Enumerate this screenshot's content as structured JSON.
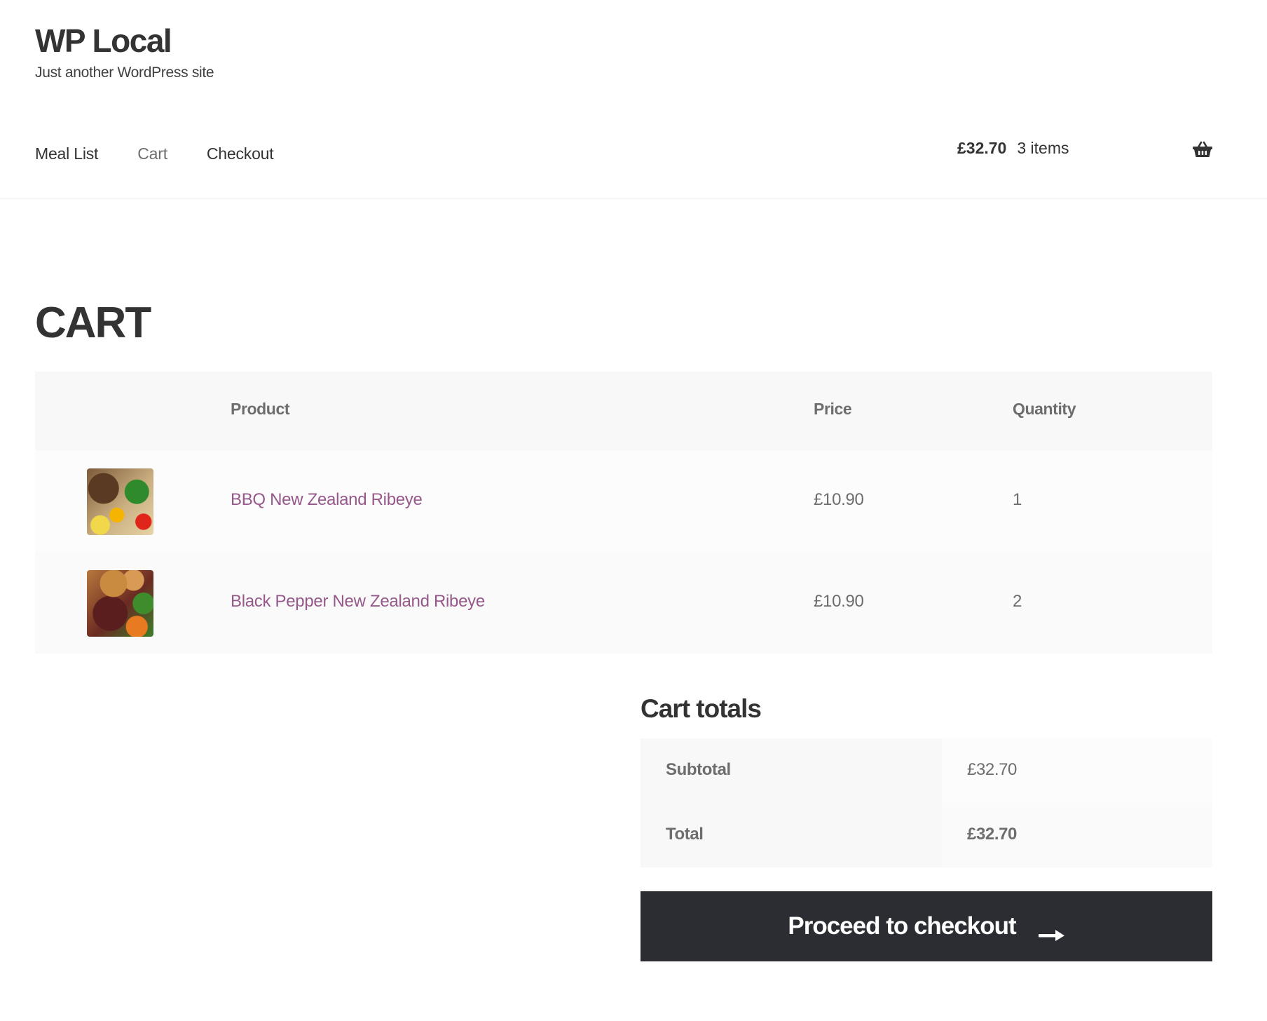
{
  "site": {
    "title": "WP Local",
    "tagline": "Just another WordPress site"
  },
  "nav": {
    "items": [
      {
        "label": "Meal List",
        "current": false
      },
      {
        "label": "Cart",
        "current": true
      },
      {
        "label": "Checkout",
        "current": false
      }
    ]
  },
  "mini_cart": {
    "amount": "£32.70",
    "count": "3 items",
    "icon": "basket-icon"
  },
  "page": {
    "title": "CART"
  },
  "cart_table": {
    "headers": {
      "thumbnail": "",
      "product": "Product",
      "price": "Price",
      "quantity": "Quantity"
    },
    "rows": [
      {
        "product": "BBQ New Zealand Ribeye",
        "price": "£10.90",
        "quantity": "1",
        "thumbnail": "food-thumbnail"
      },
      {
        "product": "Black Pepper New Zealand Ribeye",
        "price": "£10.90",
        "quantity": "2",
        "thumbnail": "food-thumbnail"
      }
    ]
  },
  "totals": {
    "title": "Cart totals",
    "subtotal_label": "Subtotal",
    "subtotal_value": "£32.70",
    "total_label": "Total",
    "total_value": "£32.70"
  },
  "checkout_button": {
    "label": "Proceed to checkout",
    "icon": "arrow-right-icon"
  },
  "colors": {
    "link": "#96588a",
    "button_bg": "#2b2d33",
    "text": "#333333",
    "muted": "#6d6d6d"
  }
}
